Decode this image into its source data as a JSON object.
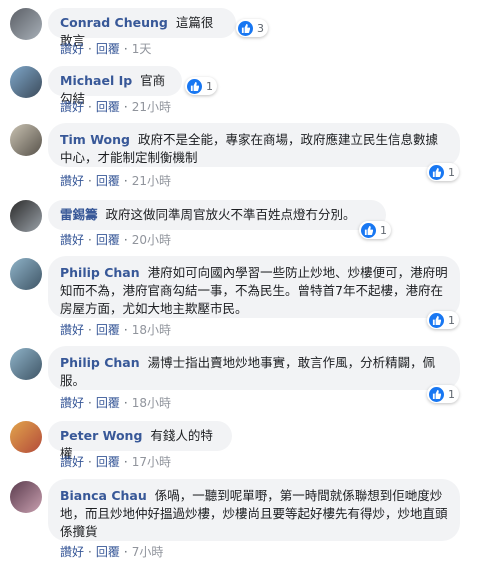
{
  "comments": [
    {
      "author": "Conrad Cheung",
      "text": "這篇很敢言",
      "likes": "3",
      "time": "1天",
      "avatar_colors": [
        "#5b5f66",
        "#a8b0b8"
      ]
    },
    {
      "author": "Michael Ip",
      "text": "官商勾結",
      "likes": "1",
      "time": "21小時",
      "avatar_colors": [
        "#7fa7c9",
        "#3b4a5a"
      ]
    },
    {
      "author": "Tim Wong",
      "text": "政府不是全能，專家在商場，政府應建立民生信息數據中心，才能制定制衡機制",
      "likes": "1",
      "time": "21小時",
      "avatar_colors": [
        "#c9c2b2",
        "#57524a"
      ]
    },
    {
      "author": "雷錫籌",
      "text": "政府这做同準周官放火不準百姓点燈冇分別。",
      "likes": "1",
      "time": "20小時",
      "avatar_colors": [
        "#2b2b2b",
        "#9aa1a8"
      ]
    },
    {
      "author": "Philip Chan",
      "text": "港府如可向國內學習一些防止炒地、炒樓便可，港府明知而不為，港府官商勾結一事，不為民生。曾特首7年不起樓，港府在房屋方面，尤如大地主欺壓市民。",
      "likes": "1",
      "time": "18小時",
      "avatar_colors": [
        "#8fb3c8",
        "#3f5566"
      ]
    },
    {
      "author": "Philip Chan",
      "text": "湯博士指出賣地炒地事實，敢言作風，分析精闢，佩服。",
      "likes": "1",
      "time": "18小時",
      "avatar_colors": [
        "#8fb3c8",
        "#3f5566"
      ]
    },
    {
      "author": "Peter Wong",
      "text": "有錢人的特權",
      "likes": "",
      "time": "17小時",
      "avatar_colors": [
        "#e2a54c",
        "#b34a3a"
      ]
    },
    {
      "author": "Bianca Chau",
      "text": "係喎，一聽到呢單嘢，第一時間就係聯想到佢哋度炒地，而且炒地仲好搵過炒樓，炒樓尚且要等起好樓先有得炒，炒地直頭係攬貨",
      "likes": "",
      "time": "7小時",
      "avatar_colors": [
        "#5a3b4d",
        "#c9a0b0"
      ]
    }
  ],
  "actions": {
    "like": "讚好",
    "reply": "回覆"
  },
  "colors": {
    "bubble": "#f2f3f5",
    "author": "#385898",
    "like": "#1877f2"
  }
}
